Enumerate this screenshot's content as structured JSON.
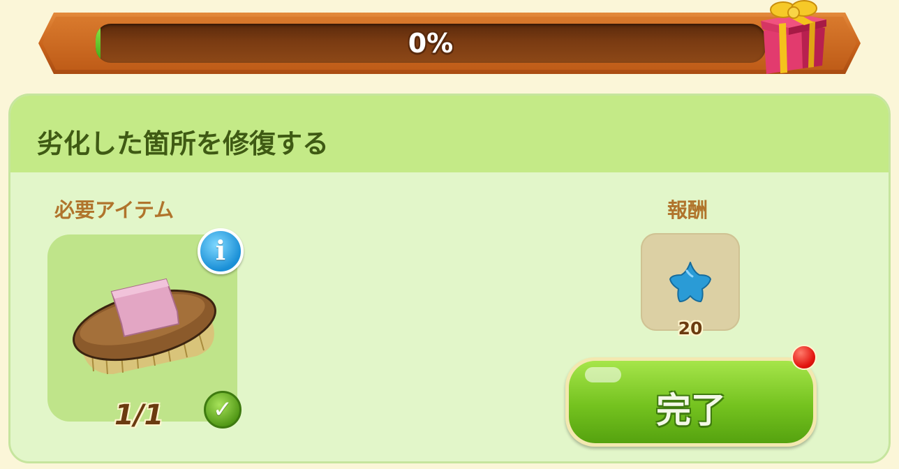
{
  "progress": {
    "label": "0%",
    "value": 0.0
  },
  "task": {
    "title": "劣化した箇所を修復する"
  },
  "required": {
    "label": "必要アイテム",
    "item_icon": "brush-icon",
    "count_text": "1/1",
    "info_icon": "info-icon",
    "check_icon": "checkmark-icon"
  },
  "reward": {
    "label": "報酬",
    "icon": "blue-star-icon",
    "value": "20"
  },
  "action": {
    "complete_label": "完了"
  },
  "colors": {
    "progress_frame": "#c8621a",
    "progress_fill": "#5dbf24",
    "panel_bg": "#e2f6c9",
    "header_bg": "#c4ea87",
    "title_text": "#3f5a14",
    "label_text": "#b0742c",
    "button_green": "#74c21f",
    "notify_red": "#e2140e"
  }
}
